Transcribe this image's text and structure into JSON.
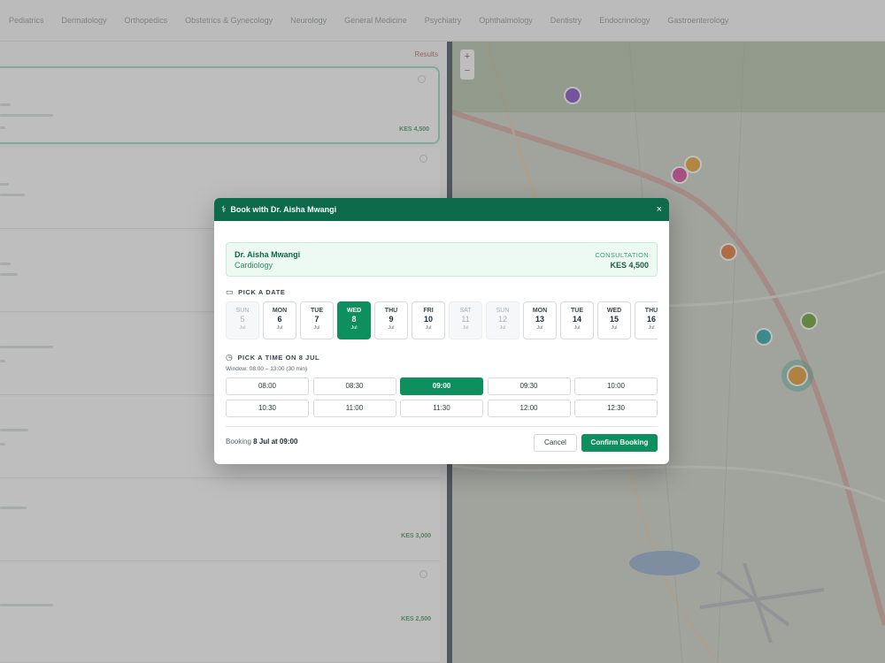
{
  "background": {
    "specialty_tabs": [
      "Pediatrics",
      "Dermatology",
      "Orthopedics",
      "Obstetrics & Gynecology",
      "Neurology",
      "General Medicine",
      "Psychiatry",
      "Ophthalmology",
      "Dentistry",
      "Endocrinology",
      "Gastroenterology"
    ],
    "results_label": "Results",
    "visible_prices": [
      "KES 4,500",
      "KES 3,000",
      "KES 2,500"
    ],
    "map_controls": [
      "+",
      "−"
    ]
  },
  "modal": {
    "title": "Book with Dr. Aisha Mwangi",
    "close_icon": "×",
    "doctor": {
      "name": "Dr. Aisha Mwangi",
      "specialty": "Cardiology",
      "fee_label": "CONSULTATION",
      "fee": "KES 4,500"
    },
    "date_section_label": "PICK A DATE",
    "dates": [
      {
        "dow": "SUN",
        "day": "5",
        "month": "Jul",
        "state": "disabled"
      },
      {
        "dow": "MON",
        "day": "6",
        "month": "Jul",
        "state": "available"
      },
      {
        "dow": "TUE",
        "day": "7",
        "month": "Jul",
        "state": "available"
      },
      {
        "dow": "WED",
        "day": "8",
        "month": "Jul",
        "state": "selected"
      },
      {
        "dow": "THU",
        "day": "9",
        "month": "Jul",
        "state": "available"
      },
      {
        "dow": "FRI",
        "day": "10",
        "month": "Jul",
        "state": "available"
      },
      {
        "dow": "SAT",
        "day": "11",
        "month": "Jul",
        "state": "disabled"
      },
      {
        "dow": "SUN",
        "day": "12",
        "month": "Jul",
        "state": "disabled"
      },
      {
        "dow": "MON",
        "day": "13",
        "month": "Jul",
        "state": "available"
      },
      {
        "dow": "TUE",
        "day": "14",
        "month": "Jul",
        "state": "available"
      },
      {
        "dow": "WED",
        "day": "15",
        "month": "Jul",
        "state": "available"
      },
      {
        "dow": "THU",
        "day": "16",
        "month": "Jul",
        "state": "available"
      }
    ],
    "time_section_label": "PICK A TIME ON 8 JUL",
    "window_note": "Window: 08:00 – 13:00 (30 min)",
    "slots": [
      {
        "time": "08:00",
        "selected": false
      },
      {
        "time": "08:30",
        "selected": false
      },
      {
        "time": "09:00",
        "selected": true
      },
      {
        "time": "09:30",
        "selected": false
      },
      {
        "time": "10:00",
        "selected": false
      },
      {
        "time": "10:30",
        "selected": false
      },
      {
        "time": "11:00",
        "selected": false
      },
      {
        "time": "11:30",
        "selected": false
      },
      {
        "time": "12:00",
        "selected": false
      },
      {
        "time": "12:30",
        "selected": false
      }
    ],
    "summary_prefix": "Booking ",
    "summary_value": "8 Jul at 09:00",
    "cancel_label": "Cancel",
    "confirm_label": "Confirm Booking"
  },
  "colors": {
    "brand_dark": "#0d6a4a",
    "brand": "#0e8f5e",
    "overlay": "rgba(110,110,110,0.45)"
  }
}
